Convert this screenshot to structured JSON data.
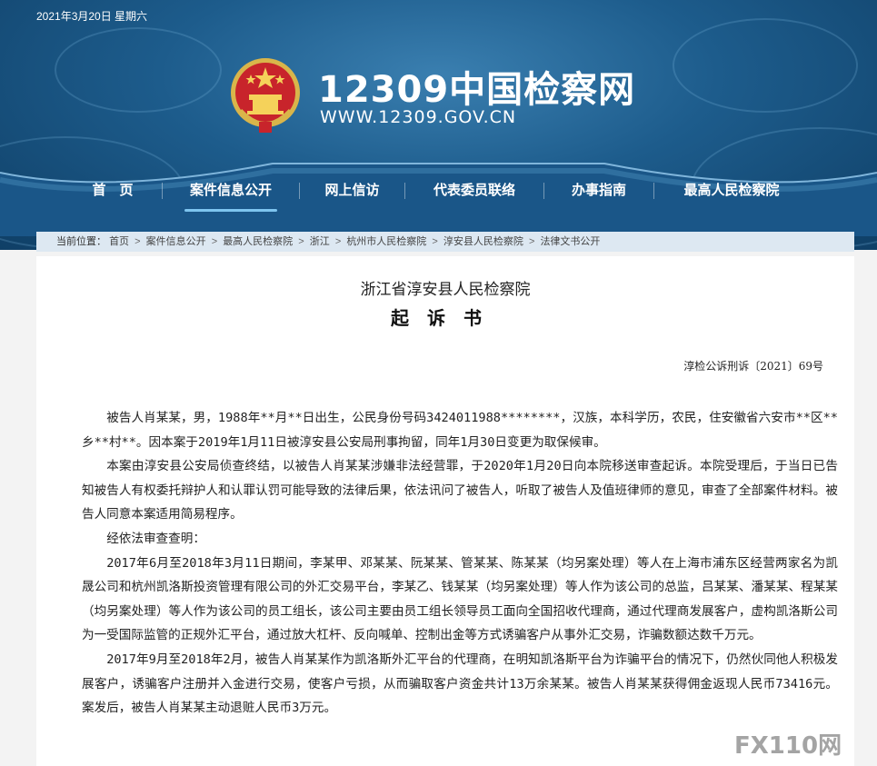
{
  "header": {
    "date": "2021年3月20日 星期六",
    "site_title": "12309中国检察网",
    "site_url": "WWW.12309.GOV.CN",
    "colors": {
      "primary": "#1d5c8c",
      "accent": "#7ec4ef",
      "background": "#ffffff"
    }
  },
  "nav": {
    "items": [
      {
        "label": "首　页",
        "active": false
      },
      {
        "label": "案件信息公开",
        "active": true
      },
      {
        "label": "网上信访",
        "active": false
      },
      {
        "label": "代表委员联络",
        "active": false
      },
      {
        "label": "办事指南",
        "active": false
      },
      {
        "label": "最高人民检察院",
        "active": false
      }
    ]
  },
  "breadcrumb": {
    "label": "当前位置：",
    "items": [
      "首页",
      "案件信息公开",
      "最高人民检察院",
      "浙江",
      "杭州市人民检察院",
      "淳安县人民检察院",
      "法律文书公开"
    ],
    "separator": ">"
  },
  "document": {
    "org": "浙江省淳安县人民检察院",
    "title": "起诉书",
    "number": "淳检公诉刑诉〔2021〕69号",
    "paragraphs": [
      "被告人肖某某，男，1988年**月**日出生，公民身份号码3424011988********，汉族，本科学历，农民，住安徽省六安市**区**乡**村**。因本案于2019年1月11日被淳安县公安局刑事拘留，同年1月30日变更为取保候审。",
      "本案由淳安县公安局侦查终结，以被告人肖某某涉嫌非法经营罪，于2020年1月20日向本院移送审查起诉。本院受理后，于当日已告知被告人有权委托辩护人和认罪认罚可能导致的法律后果，依法讯问了被告人，听取了被告人及值班律师的意见，审查了全部案件材料。被告人同意本案适用简易程序。",
      "经依法审查查明：",
      "2017年6月至2018年3月11日期间，李某甲、邓某某、阮某某、管某某、陈某某（均另案处理）等人在上海市浦东区经营两家名为凯晟公司和杭州凯洛斯投资管理有限公司的外汇交易平台，李某乙、钱某某（均另案处理）等人作为该公司的总监，吕某某、潘某某、程某某（均另案处理）等人作为该公司的员工组长，该公司主要由员工组长领导员工面向全国招收代理商，通过代理商发展客户，虚构凯洛斯公司为一受国际监管的正规外汇平台，通过放大杠杆、反向喊单、控制出金等方式诱骗客户从事外汇交易，诈骗数额达数千万元。",
      "2017年9月至2018年2月，被告人肖某某作为凯洛斯外汇平台的代理商，在明知凯洛斯平台为诈骗平台的情况下，仍然伙同他人积极发展客户，诱骗客户注册并入金进行交易，使客户亏损，从而骗取客户资金共计13万余某某。被告人肖某某获得佣金返现人民币73416元。案发后，被告人肖某某主动退赃人民币3万元。"
    ]
  },
  "watermark": {
    "text": "FX110网"
  }
}
